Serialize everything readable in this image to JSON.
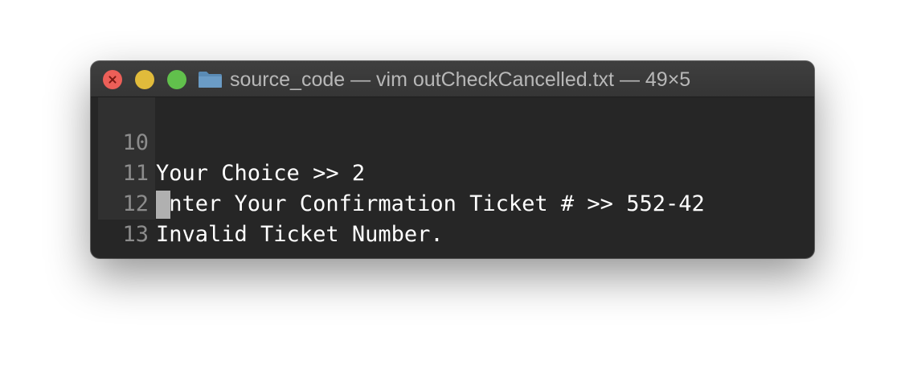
{
  "window": {
    "title": "source_code — vim outCheckCancelled.txt — 49×5",
    "folder_icon": "folder-icon",
    "traffic_lights": {
      "close": "#ec5f58",
      "minimize": "#e1bb3b",
      "zoom": "#61c04c"
    }
  },
  "editor": {
    "lines": [
      {
        "number": "10",
        "text": "Your Choice >> 2"
      },
      {
        "number": "11",
        "text": "Enter Your Confirmation Ticket # >> 552-42"
      },
      {
        "number": "12",
        "text": "Invalid Ticket Number."
      },
      {
        "number": "13",
        "text": ""
      }
    ],
    "colors": {
      "background": "#262626",
      "gutter": "#303030",
      "line_number": "#8c8c8c",
      "text": "#ffffff",
      "cursor": "#b0b0b0"
    }
  }
}
